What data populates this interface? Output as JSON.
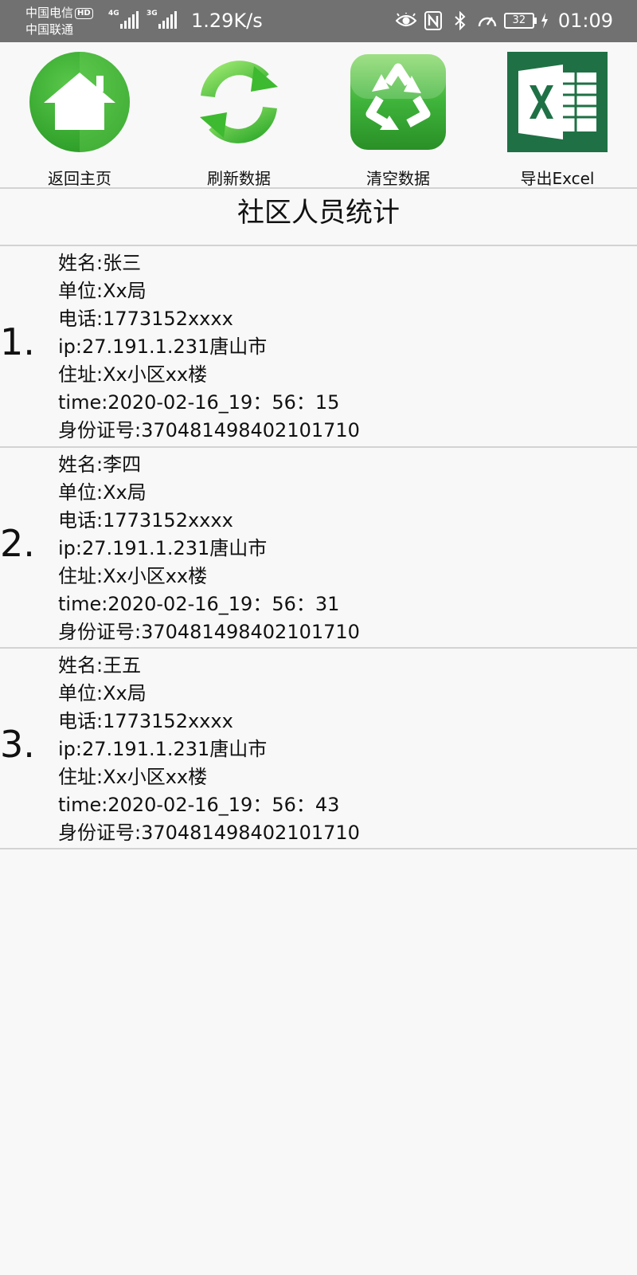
{
  "status_bar": {
    "carrier_1": "中国电信",
    "hd_badge": "HD",
    "carrier_2": "中国联通",
    "signal_1_tag": "4G",
    "signal_2_tag": "3G",
    "net_speed": "1.29K/s",
    "battery": "32",
    "time": "01:09",
    "icons": [
      "eye-comfort-icon",
      "nfc-icon",
      "bluetooth-icon",
      "speed-gauge-icon",
      "battery-icon",
      "charging-icon"
    ]
  },
  "toolbar": {
    "home_label": "返回主页",
    "refresh_label": "刷新数据",
    "clear_label": "清空数据",
    "export_label": "导出Excel"
  },
  "page": {
    "title": "社区人员统计"
  },
  "records": [
    {
      "index": "1.",
      "name": "姓名:张三",
      "unit": "单位:Xx局",
      "phone": "电话:1773152xxxx",
      "ip": "ip:27.191.1.231唐山市",
      "address": "住址:Xx小区xx楼",
      "time": "time:2020-02-16_19：56：15",
      "id_number": "身份证号:370481498402101710"
    },
    {
      "index": "2.",
      "name": "姓名:李四",
      "unit": "单位:Xx局",
      "phone": "电话:1773152xxxx",
      "ip": "ip:27.191.1.231唐山市",
      "address": "住址:Xx小区xx楼",
      "time": "time:2020-02-16_19：56：31",
      "id_number": "身份证号:370481498402101710"
    },
    {
      "index": "3.",
      "name": "姓名:王五",
      "unit": "单位:Xx局",
      "phone": "电话:1773152xxxx",
      "ip": "ip:27.191.1.231唐山市",
      "address": "住址:Xx小区xx楼",
      "time": "time:2020-02-16_19：56：43",
      "id_number": "身份证号:370481498402101710"
    }
  ],
  "colors": {
    "status_bar": "#717171",
    "background": "#f8f8f8",
    "green": "#3cb832",
    "excel_green": "#1f7145",
    "divider": "#d3d3d3"
  }
}
